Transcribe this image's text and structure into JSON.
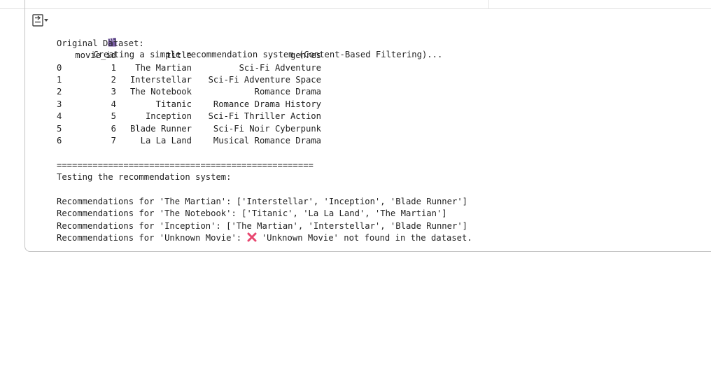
{
  "status_line": "Creating a simple recommendation system (Content-Based Filtering)...",
  "dataset": {
    "heading": "Original Dataset:",
    "columns": [
      "movie_id",
      "title",
      "genres"
    ],
    "rows": [
      {
        "index": "0",
        "movie_id": "1",
        "title": "The Martian",
        "genres": "Sci-Fi Adventure"
      },
      {
        "index": "1",
        "movie_id": "2",
        "title": "Interstellar",
        "genres": "Sci-Fi Adventure Space"
      },
      {
        "index": "2",
        "movie_id": "3",
        "title": "The Notebook",
        "genres": "Romance Drama"
      },
      {
        "index": "3",
        "movie_id": "4",
        "title": "Titanic",
        "genres": "Romance Drama History"
      },
      {
        "index": "4",
        "movie_id": "5",
        "title": "Inception",
        "genres": "Sci-Fi Thriller Action"
      },
      {
        "index": "5",
        "movie_id": "6",
        "title": "Blade Runner",
        "genres": "Sci-Fi Noir Cyberpunk"
      },
      {
        "index": "6",
        "movie_id": "7",
        "title": "La La Land",
        "genres": "Musical Romance Drama"
      }
    ]
  },
  "separator": "==================================================",
  "testing_heading": "Testing the recommendation system:",
  "recommendations": [
    "Recommendations for 'The Martian': ['Interstellar', 'Inception', 'Blade Runner']",
    "Recommendations for 'The Notebook': ['Titanic', 'La La Land', 'The Martian']",
    "Recommendations for 'Inception': ['The Martian', 'Interstellar', 'Blade Runner']"
  ],
  "not_found": {
    "prefix": "Recommendations for 'Unknown Movie': ",
    "message": " 'Unknown Movie' not found in the dataset."
  },
  "icons": {
    "output_toggle": "output-toggle-icon",
    "clapper": "clapper-board-icon",
    "error": "cross-mark-icon"
  },
  "colors": {
    "text": "#1f1f1f",
    "clapper": "#7b5ea7",
    "error_cross": "#e8466f"
  }
}
